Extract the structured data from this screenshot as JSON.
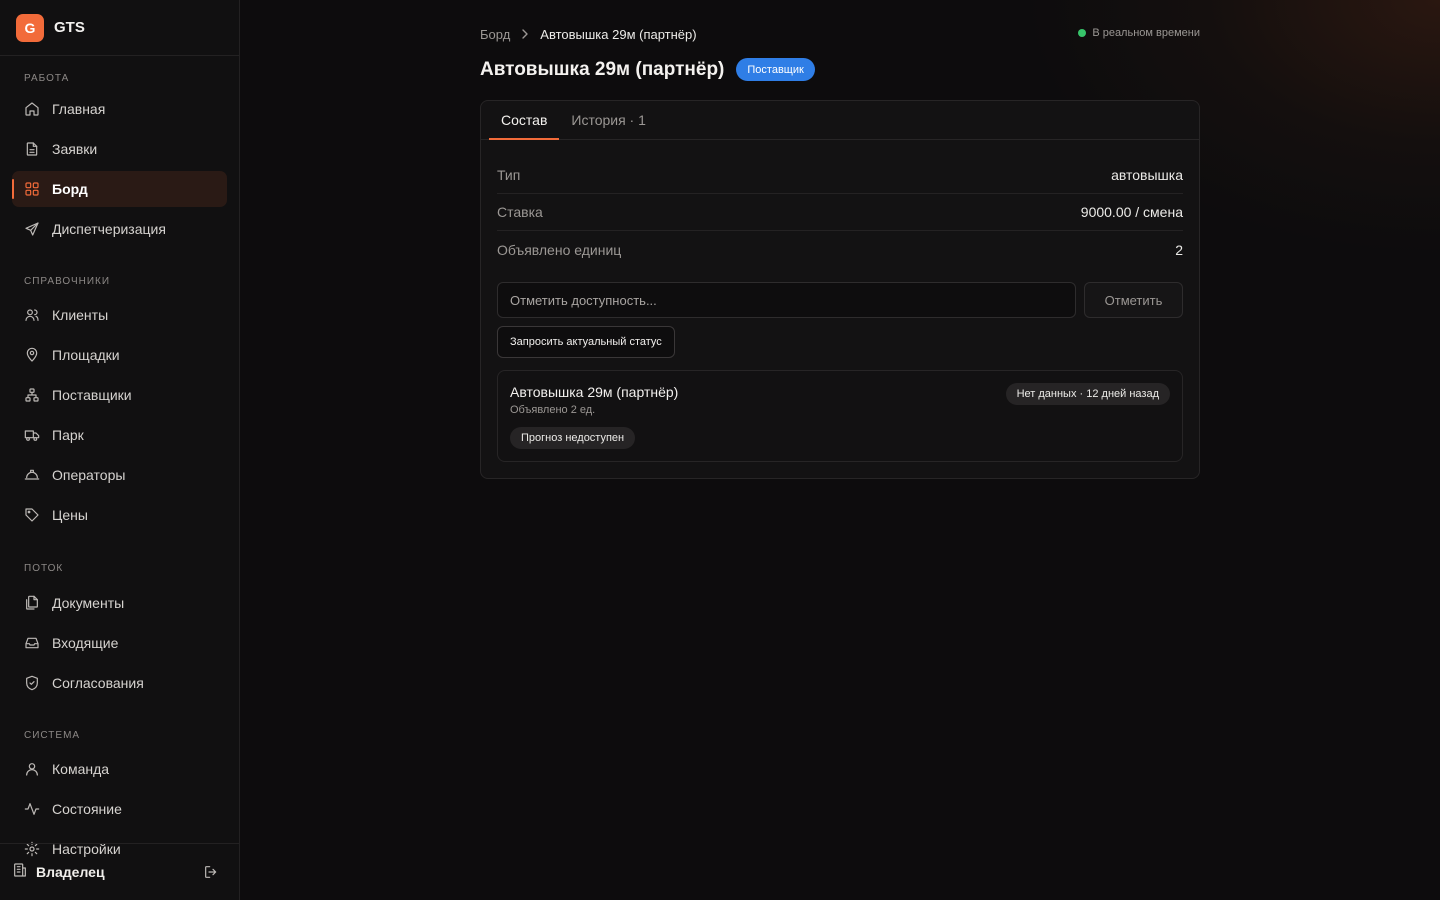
{
  "app": {
    "logo_letter": "G",
    "name": "GTS"
  },
  "sidebar": {
    "sections": [
      {
        "title": "РАБОТА",
        "items": [
          {
            "label": "Главная",
            "icon": "home-icon"
          },
          {
            "label": "Заявки",
            "icon": "file-text-icon"
          },
          {
            "label": "Борд",
            "icon": "grid-icon",
            "active": true
          },
          {
            "label": "Диспетчеризация",
            "icon": "send-icon"
          }
        ]
      },
      {
        "title": "СПРАВОЧНИКИ",
        "items": [
          {
            "label": "Клиенты",
            "icon": "users-icon"
          },
          {
            "label": "Площадки",
            "icon": "map-pin-icon"
          },
          {
            "label": "Поставщики",
            "icon": "network-icon"
          },
          {
            "label": "Парк",
            "icon": "truck-icon"
          },
          {
            "label": "Операторы",
            "icon": "hard-hat-icon"
          },
          {
            "label": "Цены",
            "icon": "tag-icon"
          }
        ]
      },
      {
        "title": "ПОТОК",
        "items": [
          {
            "label": "Документы",
            "icon": "files-icon"
          },
          {
            "label": "Входящие",
            "icon": "inbox-icon"
          },
          {
            "label": "Согласования",
            "icon": "shield-check-icon"
          }
        ]
      },
      {
        "title": "СИСТЕМА",
        "items": [
          {
            "label": "Команда",
            "icon": "user-icon"
          },
          {
            "label": "Состояние",
            "icon": "activity-icon"
          },
          {
            "label": "Настройки",
            "icon": "gear-icon"
          }
        ]
      }
    ],
    "user": {
      "name": "Владелец"
    }
  },
  "breadcrumb": {
    "parent": "Борд",
    "current": "Автовышка 29м (партнёр)"
  },
  "realtime": {
    "label": "В реальном времени",
    "color": "#37c46a"
  },
  "page": {
    "title": "Автовышка 29м (партнёр)",
    "role_badge": "Поставщик"
  },
  "tabs": [
    {
      "label": "Состав",
      "active": true
    },
    {
      "label": "История · 1",
      "active": false
    }
  ],
  "details": [
    {
      "key": "Тип",
      "value": "автовышка"
    },
    {
      "key": "Ставка",
      "value": "9000.00 / смена"
    },
    {
      "key": "Объявлено единиц",
      "value": "2"
    }
  ],
  "availability": {
    "placeholder": "Отметить доступность...",
    "value": "",
    "button": "Отметить"
  },
  "request_status_button": "Запросить актуальный статус",
  "unit": {
    "title": "Автовышка 29м (партнёр)",
    "subtitle": "Объявлено 2 ед.",
    "status": "Нет данных · 12 дней назад",
    "forecast": "Прогноз недоступен"
  },
  "colors": {
    "accent": "#f26b3a",
    "badge": "#2f7ee6",
    "background": "#0d0c0d"
  }
}
